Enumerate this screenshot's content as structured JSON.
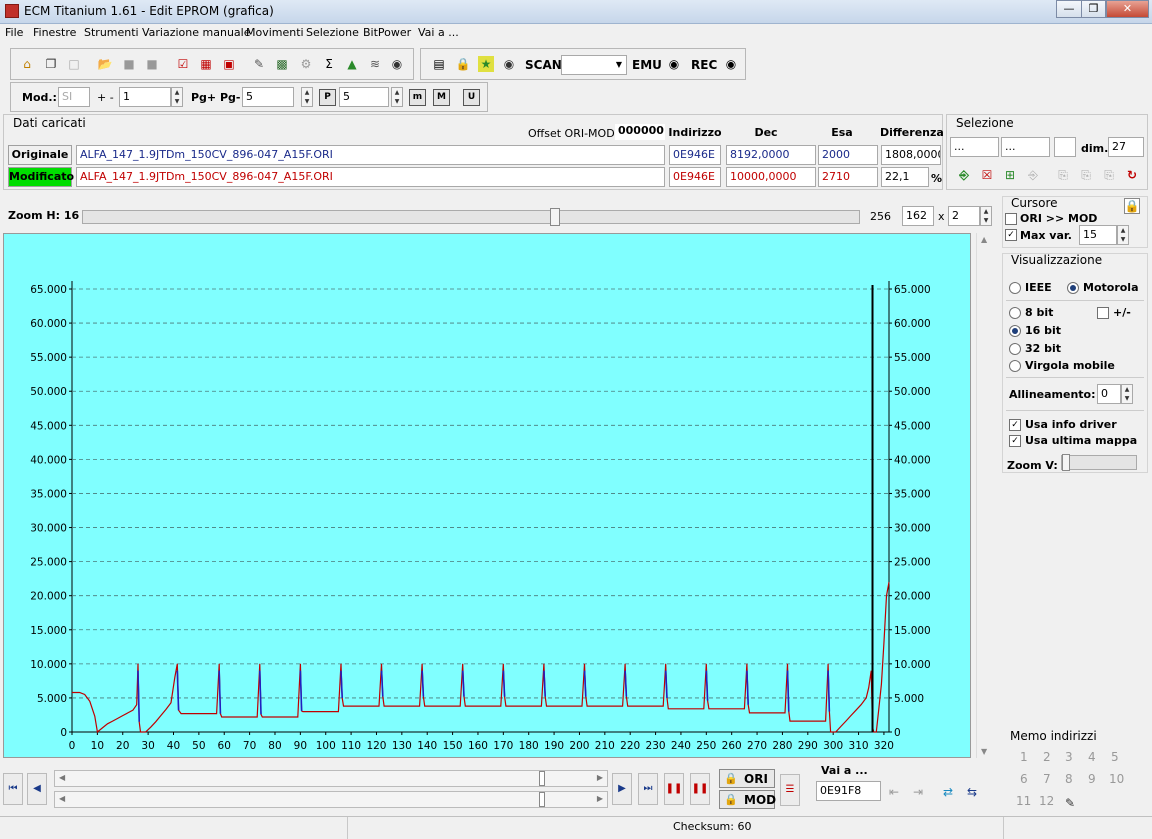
{
  "window": {
    "title": "ECM Titanium 1.61 - Edit EPROM (grafica)"
  },
  "menu": [
    "File",
    "Finestre",
    "Strumenti",
    "Variazione manuale",
    "Movimenti",
    "Selezione",
    "BitPower",
    "Vai a ..."
  ],
  "toolbar": {
    "scan_label": "SCAN",
    "emu_label": "EMU",
    "rec_label": "REC",
    "scan_value": ""
  },
  "toolbar2": {
    "mod_label": "Mod.:",
    "mod_value": "SI",
    "plusminus_label": "+ -",
    "plusminus_value": "1",
    "pg_label": "Pg+ Pg-",
    "pg_value": "5",
    "p_value": "5"
  },
  "loaded": {
    "title": "Dati caricati",
    "offset_label": "Offset ORI-MOD",
    "offset_value": "000000",
    "headers": {
      "address": "Indirizzo",
      "dec": "Dec",
      "hex": "Esa",
      "diff": "Differenza"
    },
    "original": {
      "label": "Originale",
      "file": "ALFA_147_1.9JTDm_150CV_896-047_A15F.ORI",
      "address": "0E946E",
      "dec": "8192,0000",
      "hex": "2000",
      "diff": "1808,0000"
    },
    "modified": {
      "label": "Modificato",
      "file": "ALFA_147_1.9JTDm_150CV_896-047_A15F.ORI",
      "address": "0E946E",
      "dec": "10000,0000",
      "hex": "2710",
      "diff": "22,1",
      "diff_unit": "%"
    }
  },
  "selection": {
    "title": "Selezione",
    "field1": "...",
    "field2": "...",
    "dim_label": "dim.",
    "dim_value": "27"
  },
  "zoom": {
    "label": "Zoom H: 16",
    "max_label": "256",
    "value": "162",
    "x_label": "x",
    "mult": "2",
    "slider_fraction": 0.61
  },
  "cursor": {
    "title": "Cursore",
    "ori_mod_label": "ORI >> MOD",
    "ori_mod_checked": false,
    "maxvar_label": "Max var.",
    "maxvar_checked": true,
    "maxvar_value": "15"
  },
  "display": {
    "title": "Visualizzazione",
    "ieee": "IEEE",
    "motorola": "Motorola",
    "bit8": "8 bit",
    "plusminus": "+/-",
    "bit16": "16 bit",
    "bit32": "32 bit",
    "float": "Virgola mobile",
    "align_label": "Allineamento:",
    "align_value": "0",
    "use_driver": "Usa info driver",
    "use_last_map": "Usa ultima mappa",
    "zoomv_label": "Zoom V:"
  },
  "memo": {
    "title": "Memo indirizzi",
    "items": [
      "1",
      "2",
      "3",
      "4",
      "5",
      "6",
      "7",
      "8",
      "9",
      "10",
      "11",
      "12"
    ]
  },
  "bottom": {
    "ori_label": "ORI",
    "mod_label": "MOD",
    "goto_label": "Vai a ...",
    "goto_value": "0E91F8"
  },
  "status": {
    "checksum": "Checksum: 60"
  },
  "chart_data": {
    "type": "line",
    "ylim": [
      0,
      65000
    ],
    "xlim": [
      0,
      322
    ],
    "y_ticks": [
      "0",
      "5.000",
      "10.000",
      "15.000",
      "20.000",
      "25.000",
      "30.000",
      "35.000",
      "40.000",
      "45.000",
      "50.000",
      "55.000",
      "60.000",
      "65.000"
    ],
    "x_ticks": [
      "0",
      "10",
      "20",
      "30",
      "40",
      "50",
      "60",
      "70",
      "80",
      "90",
      "100",
      "110",
      "120",
      "130",
      "140",
      "150",
      "160",
      "170",
      "180",
      "190",
      "200",
      "210",
      "220",
      "230",
      "240",
      "250",
      "260",
      "270",
      "280",
      "290",
      "300",
      "310",
      "320"
    ],
    "cursor_x": 315.5,
    "colors": {
      "background": "#80ffff",
      "line": "#c00000",
      "highlight": "#2020c0",
      "grid": "#4a7a7a"
    },
    "series": [
      {
        "points": [
          [
            0,
            5800
          ],
          [
            3,
            5800
          ],
          [
            5,
            5500
          ],
          [
            7,
            4500
          ],
          [
            9,
            2300
          ],
          [
            10,
            0
          ],
          [
            12,
            600
          ],
          [
            14,
            1200
          ],
          [
            16,
            1600
          ],
          [
            18,
            2000
          ],
          [
            20,
            2400
          ],
          [
            22,
            2800
          ],
          [
            24,
            3200
          ],
          [
            25.5,
            4000
          ],
          [
            26,
            10000
          ],
          [
            26.5,
            1500
          ],
          [
            27,
            0
          ],
          [
            29,
            0
          ],
          [
            31,
            700
          ],
          [
            33,
            1500
          ],
          [
            35,
            2400
          ],
          [
            37,
            3300
          ],
          [
            39,
            4300
          ],
          [
            40.5,
            8000
          ],
          [
            41.5,
            10000
          ],
          [
            42,
            3200
          ],
          [
            43,
            2700
          ],
          [
            57,
            2700
          ],
          [
            58,
            10000
          ],
          [
            58.5,
            2700
          ],
          [
            59,
            2200
          ],
          [
            73,
            2200
          ],
          [
            74,
            10000
          ],
          [
            74.5,
            2600
          ],
          [
            75,
            2200
          ],
          [
            89,
            2200
          ],
          [
            90,
            10000
          ],
          [
            90.5,
            3100
          ],
          [
            91,
            3000
          ],
          [
            105,
            3000
          ],
          [
            106,
            10000
          ],
          [
            106.5,
            5000
          ],
          [
            107,
            3800
          ],
          [
            121,
            3800
          ],
          [
            122,
            10000
          ],
          [
            122.5,
            5200
          ],
          [
            123,
            3800
          ],
          [
            137,
            3800
          ],
          [
            138,
            10000
          ],
          [
            138.5,
            5200
          ],
          [
            139,
            3800
          ],
          [
            153,
            3800
          ],
          [
            154,
            10000
          ],
          [
            154.5,
            5200
          ],
          [
            155,
            3800
          ],
          [
            169,
            3800
          ],
          [
            170,
            10000
          ],
          [
            170.5,
            5200
          ],
          [
            171,
            3800
          ],
          [
            185,
            3800
          ],
          [
            186,
            10000
          ],
          [
            186.5,
            5200
          ],
          [
            187,
            3800
          ],
          [
            201,
            3800
          ],
          [
            202,
            10000
          ],
          [
            202.5,
            5200
          ],
          [
            203,
            3800
          ],
          [
            217,
            3800
          ],
          [
            218,
            10000
          ],
          [
            218.5,
            5200
          ],
          [
            219,
            3800
          ],
          [
            233,
            3800
          ],
          [
            234,
            10000
          ],
          [
            234.5,
            5000
          ],
          [
            235,
            3400
          ],
          [
            249,
            3400
          ],
          [
            250,
            10000
          ],
          [
            250.5,
            4600
          ],
          [
            251,
            3400
          ],
          [
            265,
            3400
          ],
          [
            266,
            10000
          ],
          [
            266.5,
            4000
          ],
          [
            267,
            2800
          ],
          [
            281,
            2800
          ],
          [
            282,
            10000
          ],
          [
            282.5,
            3000
          ],
          [
            283,
            1600
          ],
          [
            297,
            1600
          ],
          [
            298,
            10000
          ],
          [
            298.5,
            3000
          ],
          [
            299,
            0
          ],
          [
            301,
            0
          ],
          [
            303,
            800
          ],
          [
            305,
            1600
          ],
          [
            307,
            2400
          ],
          [
            309,
            3200
          ],
          [
            311,
            4000
          ],
          [
            313,
            5000
          ],
          [
            314,
            6500
          ],
          [
            315,
            9000
          ],
          [
            315.5,
            700
          ],
          [
            316,
            0
          ],
          [
            317,
            0
          ],
          [
            318,
            3500
          ],
          [
            319,
            7000
          ],
          [
            320,
            13000
          ],
          [
            321,
            20000
          ],
          [
            322,
            22000
          ]
        ]
      }
    ]
  }
}
